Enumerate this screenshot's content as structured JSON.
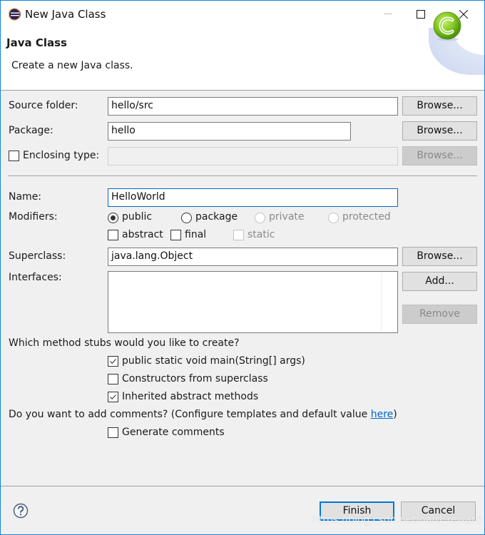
{
  "window": {
    "title": "New Java Class",
    "app_icon": "eclipse-icon",
    "controls": [
      "minimize",
      "maximize",
      "close"
    ]
  },
  "header": {
    "title": "Java Class",
    "description": "Create a new Java class.",
    "banner_icon": "java-class-icon"
  },
  "form": {
    "source_folder": {
      "label": "Source folder:",
      "value": "hello/src",
      "browse": "Browse..."
    },
    "package": {
      "label": "Package:",
      "value": "hello",
      "browse": "Browse..."
    },
    "enclosing_type": {
      "label": "Enclosing type:",
      "checked": false,
      "value": "",
      "browse": "Browse...",
      "enabled": false
    },
    "name": {
      "label": "Name:",
      "value": "HelloWorld"
    },
    "modifiers": {
      "label": "Modifiers:",
      "access": [
        {
          "label": "public",
          "selected": true,
          "enabled": true
        },
        {
          "label": "package",
          "selected": false,
          "enabled": true
        },
        {
          "label": "private",
          "selected": false,
          "enabled": false
        },
        {
          "label": "protected",
          "selected": false,
          "enabled": false
        }
      ],
      "flags": [
        {
          "label": "abstract",
          "checked": false,
          "enabled": true
        },
        {
          "label": "final",
          "checked": false,
          "enabled": true
        },
        {
          "label": "static",
          "checked": false,
          "enabled": false
        }
      ]
    },
    "superclass": {
      "label": "Superclass:",
      "value": "java.lang.Object",
      "browse": "Browse..."
    },
    "interfaces": {
      "label": "Interfaces:",
      "items": [],
      "add": "Add...",
      "remove": "Remove"
    },
    "stubs": {
      "question": "Which method stubs would you like to create?",
      "options": [
        {
          "label": "public static void main(String[] args)",
          "checked": true
        },
        {
          "label": "Constructors from superclass",
          "checked": false
        },
        {
          "label": "Inherited abstract methods",
          "checked": true
        }
      ]
    },
    "comments": {
      "question_prefix": "Do you want to add comments? (Configure templates and default value ",
      "link": "here",
      "question_suffix": ")",
      "option": {
        "label": "Generate comments",
        "checked": false
      }
    }
  },
  "footer": {
    "help_icon": "help-icon",
    "finish": "Finish",
    "cancel": "Cancel",
    "watermark": "https://blog.csdn.net/hard_reward"
  },
  "colors": {
    "accent": "#0078d7",
    "link": "#0066cc",
    "window_border": "#1883d7"
  }
}
